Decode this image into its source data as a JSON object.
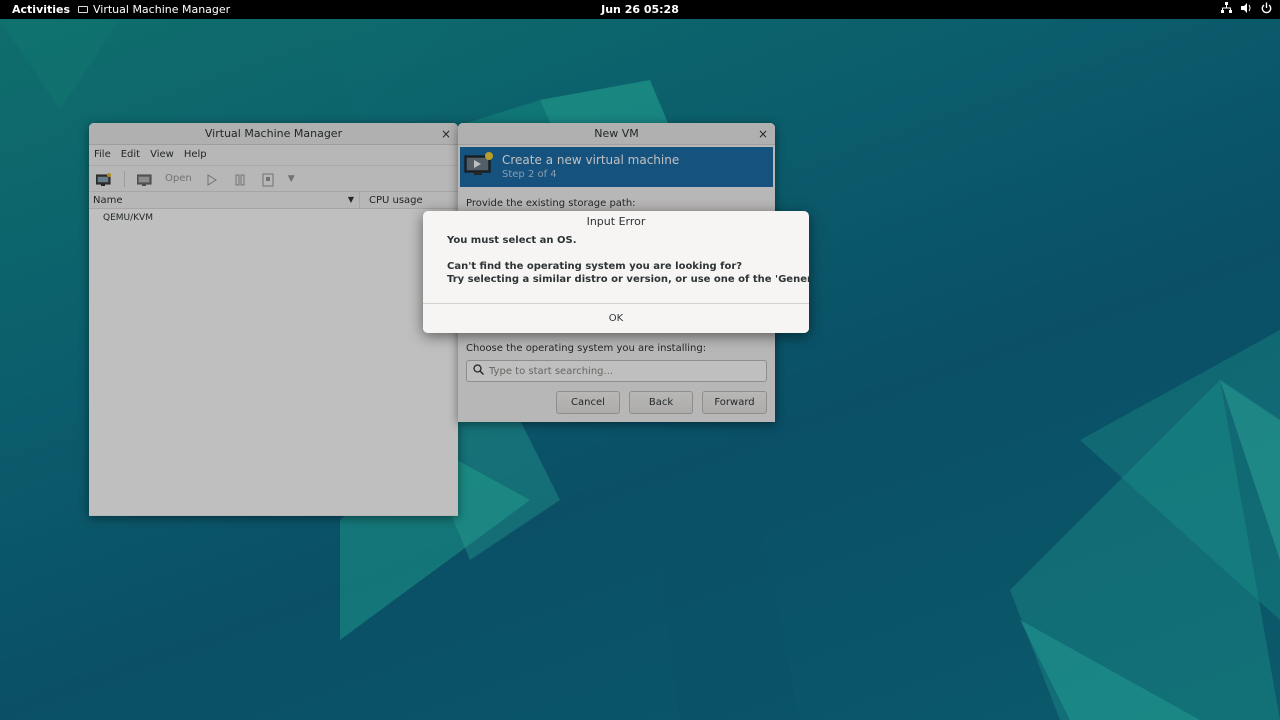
{
  "topbar": {
    "activities": "Activities",
    "app_name": "Virtual Machine Manager",
    "clock": "Jun 26  05:28",
    "icons": [
      "network-icon",
      "volume-icon",
      "power-icon"
    ]
  },
  "vmm": {
    "title": "Virtual Machine Manager",
    "menu": [
      "File",
      "Edit",
      "View",
      "Help"
    ],
    "toolbar": {
      "open_label": "Open"
    },
    "columns": {
      "name": "Name",
      "cpu": "CPU usage"
    },
    "connections": [
      "QEMU/KVM"
    ]
  },
  "newvm": {
    "title": "New VM",
    "header_title": "Create a new virtual machine",
    "header_step": "Step 2 of 4",
    "storage_label": "Provide the existing storage path:",
    "os_label": "Choose the operating system you are installing:",
    "search_placeholder": "Type to start searching...",
    "buttons": {
      "cancel": "Cancel",
      "back": "Back",
      "forward": "Forward"
    }
  },
  "dialog": {
    "title": "Input Error",
    "primary": "You must select an OS.",
    "secondary_line1": "Can't find the operating system you are looking for?",
    "secondary_line2": "Try selecting a similar distro or version, or use one of the 'Generic' options.",
    "ok": "OK"
  },
  "colors": {
    "header_blue": "#1e6ea8",
    "wallpaper_teal": "#0b5d6c"
  }
}
